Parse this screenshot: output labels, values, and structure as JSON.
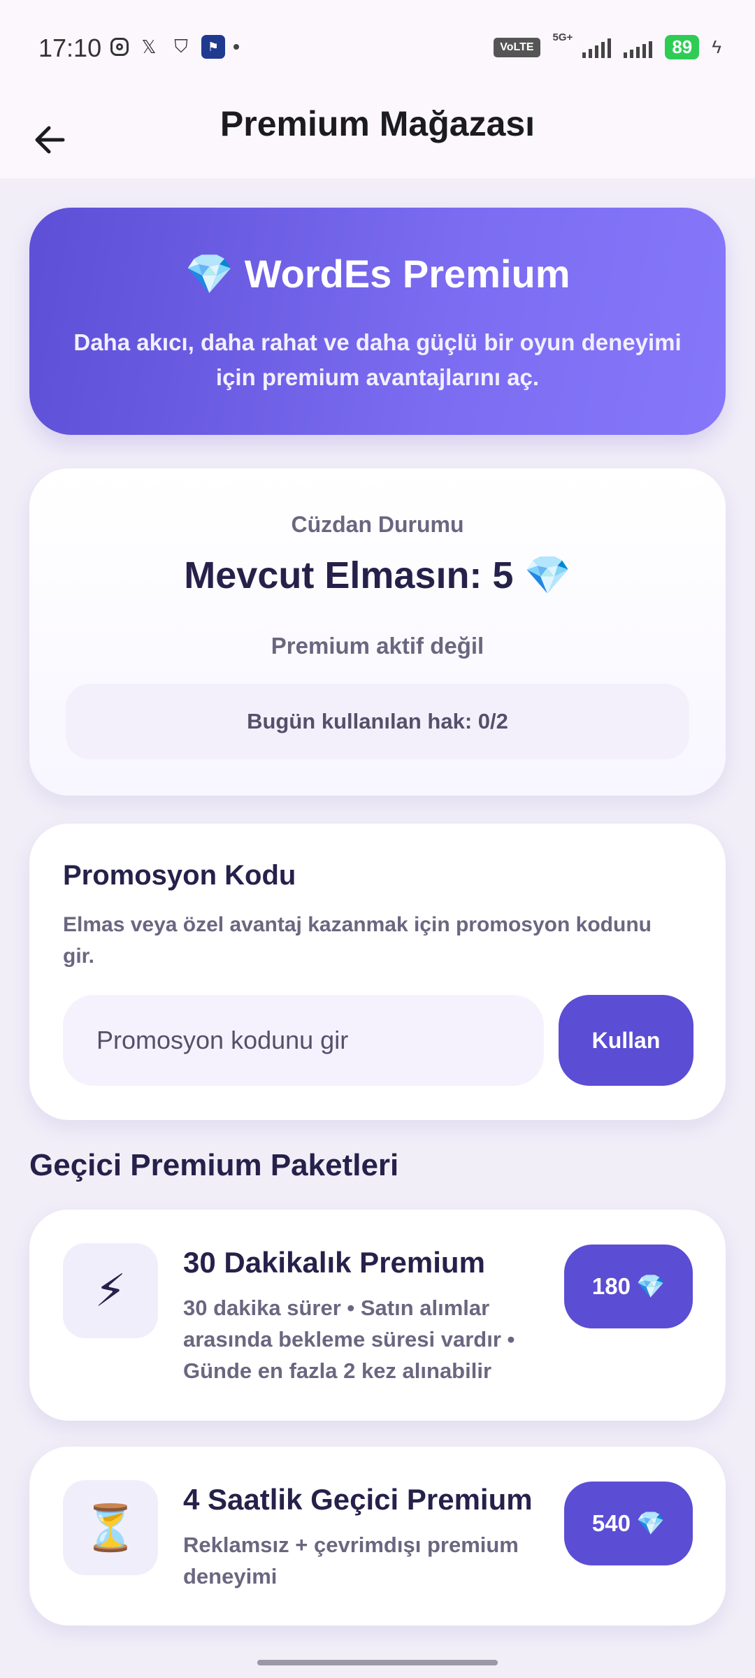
{
  "status_bar": {
    "time": "17:10",
    "volte": "VoLTE",
    "network": "5G+",
    "battery": "89"
  },
  "app_bar": {
    "title": "Premium Mağazası"
  },
  "hero": {
    "title": "💎 WordEs Premium",
    "subtitle": "Daha akıcı, daha rahat ve daha güçlü bir oyun deneyimi için premium avantajlarını aç."
  },
  "wallet": {
    "label": "Cüzdan Durumu",
    "amount": "Mevcut Elmasın: 5 💎",
    "premium_status": "Premium aktif değil",
    "usage": "Bugün kullanılan hak: 0/2"
  },
  "promo": {
    "title": "Promosyon Kodu",
    "description": "Elmas veya özel avantaj kazanmak için promosyon kodunu gir.",
    "placeholder": "Promosyon kodunu gir",
    "button": "Kullan"
  },
  "section": {
    "title": "Geçici Premium Paketleri"
  },
  "packages": [
    {
      "icon": "⚡",
      "title": "30 Dakikalık Premium",
      "description": "30 dakika sürer • Satın alımlar arasında bekleme süresi vardır • Günde en fazla 2 kez alınabilir",
      "price": "180",
      "currency_icon": "💎"
    },
    {
      "icon": "⏳",
      "title": "4 Saatlik Geçici Premium",
      "description": "Reklamsız + çevrimdışı premium deneyimi",
      "price": "540",
      "currency_icon": "💎"
    }
  ],
  "colors": {
    "accent": "#5b4dd4",
    "hero_start": "#5d4fd6",
    "hero_end": "#8677fa",
    "background": "#f1eef8"
  }
}
